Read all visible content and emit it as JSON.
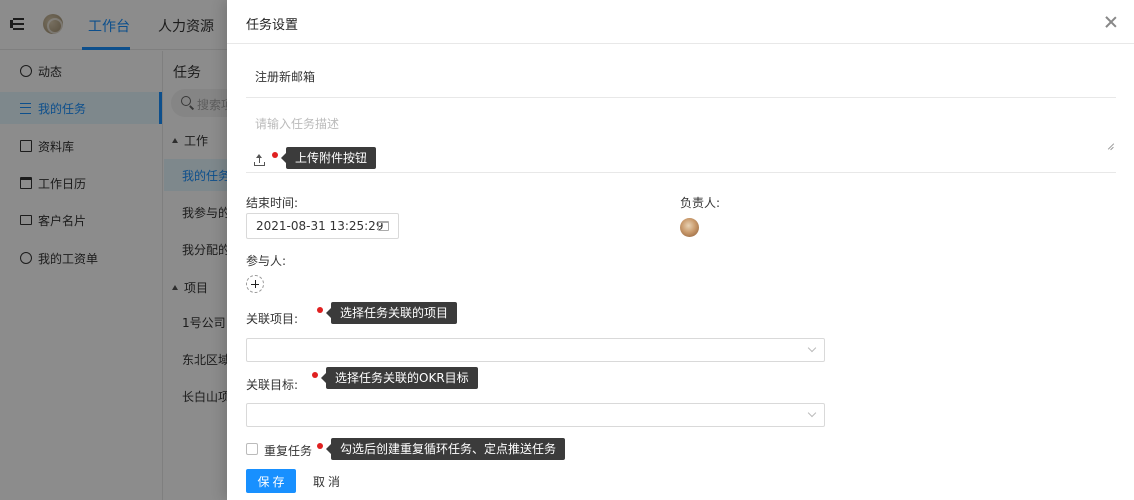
{
  "topbar": {
    "tabs": [
      {
        "label": "工作台",
        "active": true
      },
      {
        "label": "人力资源",
        "active": false
      }
    ],
    "accent_color": "#1890ff"
  },
  "sidebar": {
    "items": [
      {
        "label": "动态",
        "icon": "gauge-icon"
      },
      {
        "label": "我的任务",
        "icon": "list-icon",
        "active": true
      },
      {
        "label": "资料库",
        "icon": "book-icon"
      },
      {
        "label": "工作日历",
        "icon": "calendar-icon"
      },
      {
        "label": "客户名片",
        "icon": "card-icon"
      },
      {
        "label": "我的工资单",
        "icon": "coin-icon"
      }
    ]
  },
  "tasks_panel": {
    "title": "任务",
    "search_placeholder": "搜索项",
    "groups": [
      {
        "label": "工作",
        "items": [
          "我的任务",
          "我参与的",
          "我分配的"
        ]
      },
      {
        "label": "项目",
        "items": [
          "1号公司",
          "东北区域",
          "长白山项"
        ]
      }
    ]
  },
  "drawer": {
    "title": "任务设置",
    "task_name": "注册新邮箱",
    "description_placeholder": "请输入任务描述",
    "upload_tooltip": "上传附件按钮",
    "end_time_label": "结束时间:",
    "end_time_value": "2021-08-31 13:25:29",
    "owner_label": "负责人:",
    "participants_label": "参与人:",
    "project_label": "关联项目:",
    "project_tooltip": "选择任务关联的项目",
    "okr_label": "关联目标:",
    "okr_tooltip": "选择任务关联的OKR目标",
    "repeat_label": "重复任务",
    "repeat_checked": false,
    "repeat_tooltip": "勾选后创建重复循环任务、定点推送任务",
    "save_label": "保存",
    "cancel_label": "取消"
  },
  "colors": {
    "primary": "#1890ff",
    "tooltip_bg": "#3b3b3b",
    "marker_dot": "#e02020"
  }
}
